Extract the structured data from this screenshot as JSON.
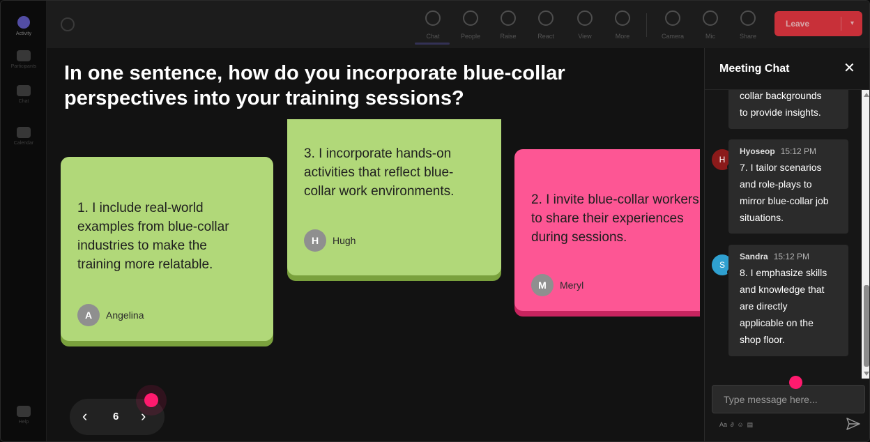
{
  "rail": {
    "items": [
      {
        "label": "Activity"
      },
      {
        "label": "Participants"
      },
      {
        "label": "Chat"
      },
      {
        "label": "Calendar"
      },
      {
        "label": "Help"
      }
    ]
  },
  "toolbar": {
    "buttons": [
      {
        "label": "Chat",
        "icon": "chat-icon"
      },
      {
        "label": "People",
        "icon": "people-icon"
      },
      {
        "label": "Raise",
        "icon": "raise-hand-icon"
      },
      {
        "label": "React",
        "icon": "react-icon"
      },
      {
        "label": "View",
        "icon": "view-icon"
      },
      {
        "label": "More",
        "icon": "more-icon"
      },
      {
        "label": "Camera",
        "icon": "camera-icon"
      },
      {
        "label": "Mic",
        "icon": "mic-icon"
      },
      {
        "label": "Share",
        "icon": "share-icon"
      }
    ],
    "leave_label": "Leave"
  },
  "stage": {
    "question": "In one sentence, how do you incorporate blue-collar perspectives into your training sessions?",
    "cards": [
      {
        "text": "1. I include real-world\nexamples from blue-collar\nindustries to make the\ntraining more relatable.",
        "author": "Angelina",
        "initial": "A",
        "color": "#b1d879"
      },
      {
        "text": "3. I incorporate hands-on\nactivities that reflect blue-\ncollar work environments.",
        "author": "Hugh",
        "initial": "H",
        "color": "#b1d879"
      },
      {
        "text": "2. I invite blue-collar workers\nto share their experiences\nduring sessions.",
        "author": "Meryl",
        "initial": "M",
        "color": "#fd5694"
      }
    ]
  },
  "pager": {
    "current": "6",
    "prev_icon": "chevron-left-icon",
    "next_icon": "chevron-right-icon"
  },
  "chat": {
    "title": "Meeting Chat",
    "messages": [
      {
        "text": "collar backgrounds\nto provide insights."
      },
      {
        "name": "Hyoseop",
        "initial": "H",
        "time": "15:12 PM",
        "avatar_color": "#8b1a1a",
        "text": "7. I tailor scenarios\nand role-plays to\nmirror blue-collar job\nsituations."
      },
      {
        "name": "Sandra",
        "initial": "S",
        "time": "15:12 PM",
        "avatar_color": "#2fa0d0",
        "text": "8. I emphasize skills\nand knowledge that\nare directly\napplicable on the\nshop floor."
      }
    ],
    "input_placeholder": "Type message here..."
  }
}
